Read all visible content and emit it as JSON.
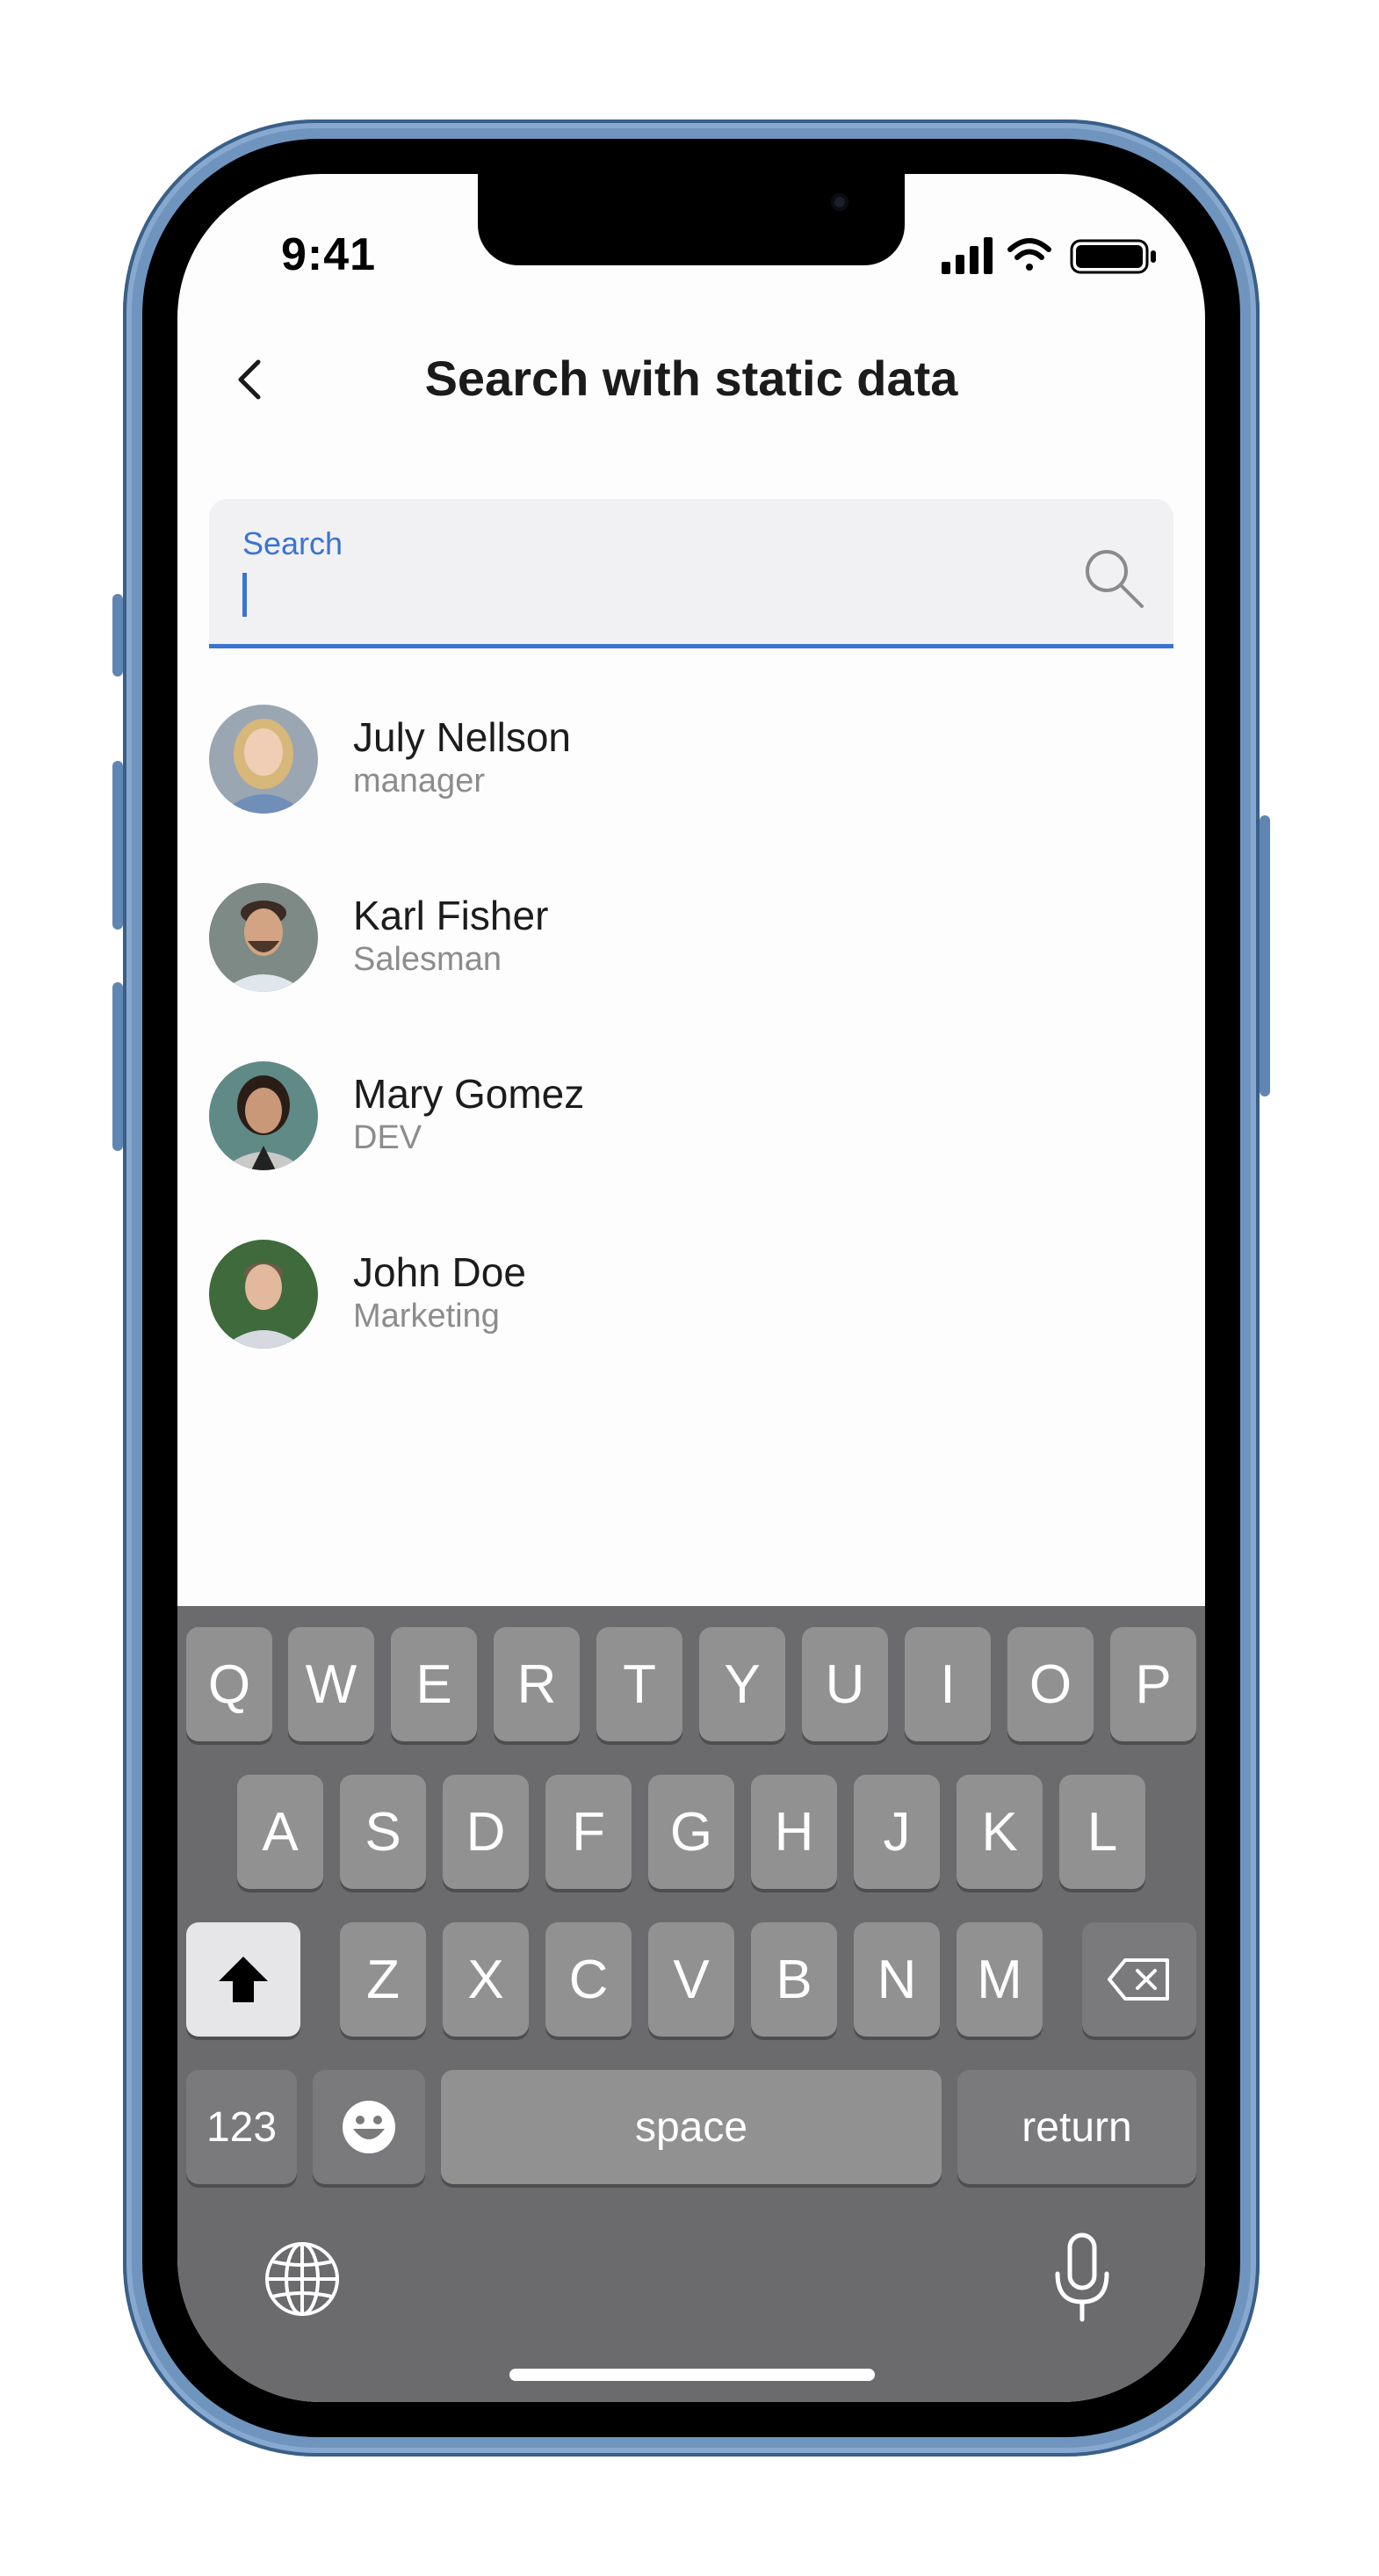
{
  "status_bar": {
    "time": "9:41"
  },
  "header": {
    "title": "Search with static data",
    "back_icon": "chevron-left-icon"
  },
  "search": {
    "label": "Search",
    "value": "",
    "placeholder": "",
    "icon": "search-icon"
  },
  "contacts": [
    {
      "name": "July Nellson",
      "role": "manager"
    },
    {
      "name": "Karl Fisher",
      "role": "Salesman"
    },
    {
      "name": "Mary Gomez",
      "role": "DEV"
    },
    {
      "name": "John Doe",
      "role": "Marketing"
    }
  ],
  "keyboard": {
    "row1": [
      "Q",
      "W",
      "E",
      "R",
      "T",
      "Y",
      "U",
      "I",
      "O",
      "P"
    ],
    "row2": [
      "A",
      "S",
      "D",
      "F",
      "G",
      "H",
      "J",
      "K",
      "L"
    ],
    "row3": [
      "Z",
      "X",
      "C",
      "V",
      "B",
      "N",
      "M"
    ],
    "numbers": "123",
    "space": "space",
    "return": "return",
    "icons": [
      "shift-icon",
      "backspace-icon",
      "emoji-icon",
      "globe-icon",
      "microphone-icon"
    ]
  },
  "colors": {
    "accent": "#3b73d0",
    "frame": "#6f95bf",
    "keyboard_bg": "#6b6b6d"
  }
}
